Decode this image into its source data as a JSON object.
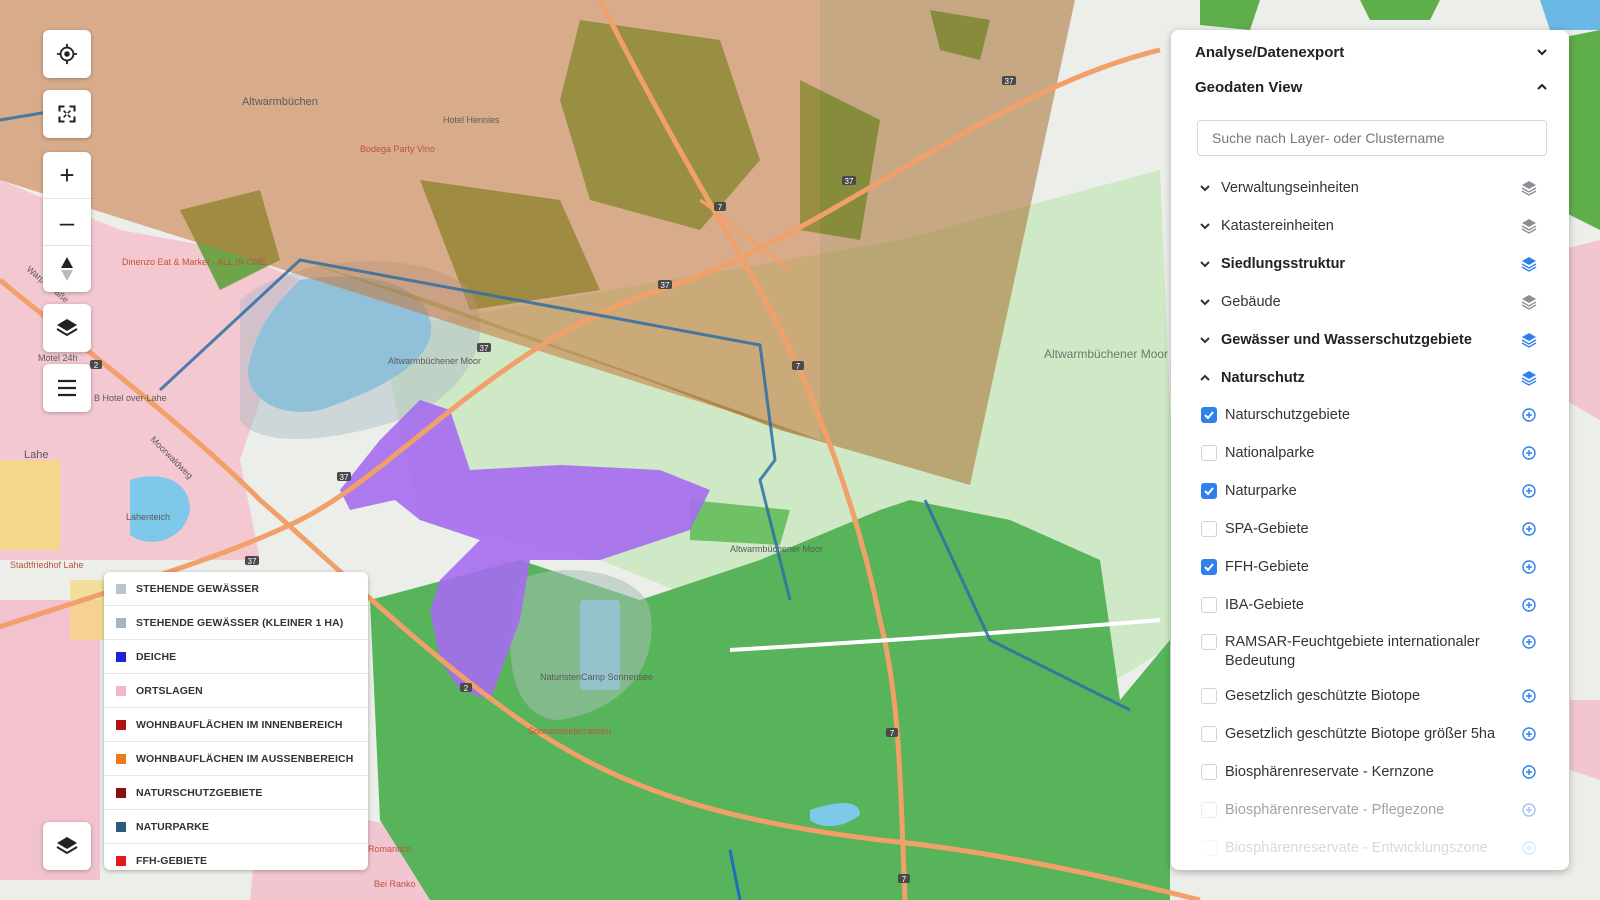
{
  "map": {
    "places": [
      {
        "name": "Altwarmbüchen"
      },
      {
        "name": "Hotel Hennies"
      },
      {
        "name": "Bodega Party Vino"
      },
      {
        "name": "Lahe"
      },
      {
        "name": "Motel 24h"
      },
      {
        "name": "B Hotel over-Lahe"
      },
      {
        "name": "Dinenzo Eat & Market - ALL IN ONE"
      },
      {
        "name": "Altwarmbüchener Moor",
        "kind": "first"
      },
      {
        "name": "Altwarmbüchener Moor",
        "kind": "second"
      },
      {
        "name": "Altwarmbüchener Moor",
        "kind": "third"
      },
      {
        "name": "NaturistenCamp Sonnensee"
      },
      {
        "name": "Sonnenseeterrassen"
      },
      {
        "name": "Lahenteich"
      },
      {
        "name": "Stadtfriedhof Lahe"
      },
      {
        "name": "Romantico"
      },
      {
        "name": "Bei Ranko"
      },
      {
        "name": "Moorwaldweg"
      },
      {
        "name": "Warpestraße"
      }
    ],
    "road_labels": [
      "37",
      "37",
      "37",
      "37",
      "37",
      "2",
      "2",
      "7",
      "7",
      "7",
      "7",
      "37"
    ]
  },
  "controls": {
    "locate_icon": "crosshair-icon",
    "fullscreen_icon": "fullscreen-icon",
    "zoom_in_label": "+",
    "zoom_out_label": "–",
    "compass_icon": "compass-icon",
    "layers_icon": "layers-icon",
    "menu_icon": "hamburger-icon"
  },
  "legend": {
    "items": [
      {
        "label": "STEHENDE GEWÄSSER",
        "color": "#b8c4d0"
      },
      {
        "label": "STEHENDE GEWÄSSER (KLEINER 1 HA)",
        "color": "#a6b4c2"
      },
      {
        "label": "DEICHE",
        "color": "#1f22d6"
      },
      {
        "label": "ORTSLAGEN",
        "color": "#f4b6c6"
      },
      {
        "label": "WOHNBAUFLÄCHEN IM INNENBEREICH",
        "color": "#b11212"
      },
      {
        "label": "WOHNBAUFLÄCHEN IM AUSSENBEREICH",
        "color": "#f07a18"
      },
      {
        "label": "NATURSCHUTZGEBIETE",
        "color": "#8a1010"
      },
      {
        "label": "NATURPARKE",
        "color": "#2d5b7c"
      },
      {
        "label": "FFH-GEBIETE",
        "color": "#e8171b"
      }
    ]
  },
  "panel": {
    "section1_title": "Analyse/Datenexport",
    "section2_title": "Geodaten View",
    "search_placeholder": "Suche nach Layer- oder Clustername",
    "search_value": "",
    "categories": [
      {
        "label": "Verwaltungseinheiten",
        "bold": false,
        "expanded": false,
        "layer_color": "#8a8f96"
      },
      {
        "label": "Katastereinheiten",
        "bold": false,
        "expanded": false,
        "layer_color": "#8a8f96"
      },
      {
        "label": "Siedlungsstruktur",
        "bold": true,
        "expanded": false,
        "layer_color": "#2f80ed"
      },
      {
        "label": "Gebäude",
        "bold": false,
        "expanded": false,
        "layer_color": "#8a8f96"
      },
      {
        "label": "Gewässer und Wasserschutzgebiete",
        "bold": true,
        "expanded": false,
        "layer_color": "#2f80ed"
      },
      {
        "label": "Naturschutz",
        "bold": true,
        "expanded": true,
        "layer_color": "#2f80ed"
      }
    ],
    "naturschutz_items": [
      {
        "label": "Naturschutzgebiete",
        "checked": true
      },
      {
        "label": "Nationalparke",
        "checked": false
      },
      {
        "label": "Naturparke",
        "checked": true
      },
      {
        "label": "SPA-Gebiete",
        "checked": false
      },
      {
        "label": "FFH-Gebiete",
        "checked": true
      },
      {
        "label": "IBA-Gebiete",
        "checked": false
      },
      {
        "label": "RAMSAR-Feuchtgebiete internationaler Bedeutung",
        "checked": false
      },
      {
        "label": "Gesetzlich geschützte Biotope",
        "checked": false
      },
      {
        "label": "Gesetzlich geschützte Biotope größer 5ha",
        "checked": false
      },
      {
        "label": "Biosphärenreservate - Kernzone",
        "checked": false
      },
      {
        "label": "Biosphärenreservate - Pflegezone",
        "checked": false
      },
      {
        "label": "Biosphärenreservate - Entwicklungszone",
        "checked": false
      }
    ]
  }
}
